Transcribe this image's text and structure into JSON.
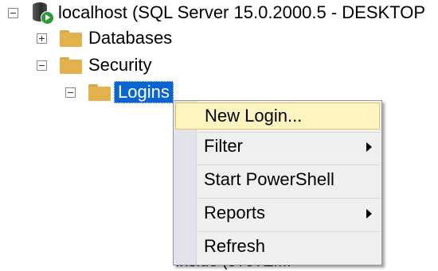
{
  "tree": {
    "server": "localhost (SQL Server 15.0.2000.5 - DESKTOP",
    "databases": "Databases",
    "security": "Security",
    "logins": "Logins",
    "hidden_row": "Insiue (o?o?EMI"
  },
  "context_menu": {
    "items": [
      {
        "label": "New Login...",
        "submenu": false
      },
      {
        "label": "Filter",
        "submenu": true
      },
      {
        "label": "Start PowerShell",
        "submenu": false
      },
      {
        "label": "Reports",
        "submenu": true
      },
      {
        "label": "Refresh",
        "submenu": false
      }
    ]
  },
  "colors": {
    "selection": "#0a64d2",
    "menu_highlight": "#fdf4bf",
    "folder": "#e3b24f"
  }
}
